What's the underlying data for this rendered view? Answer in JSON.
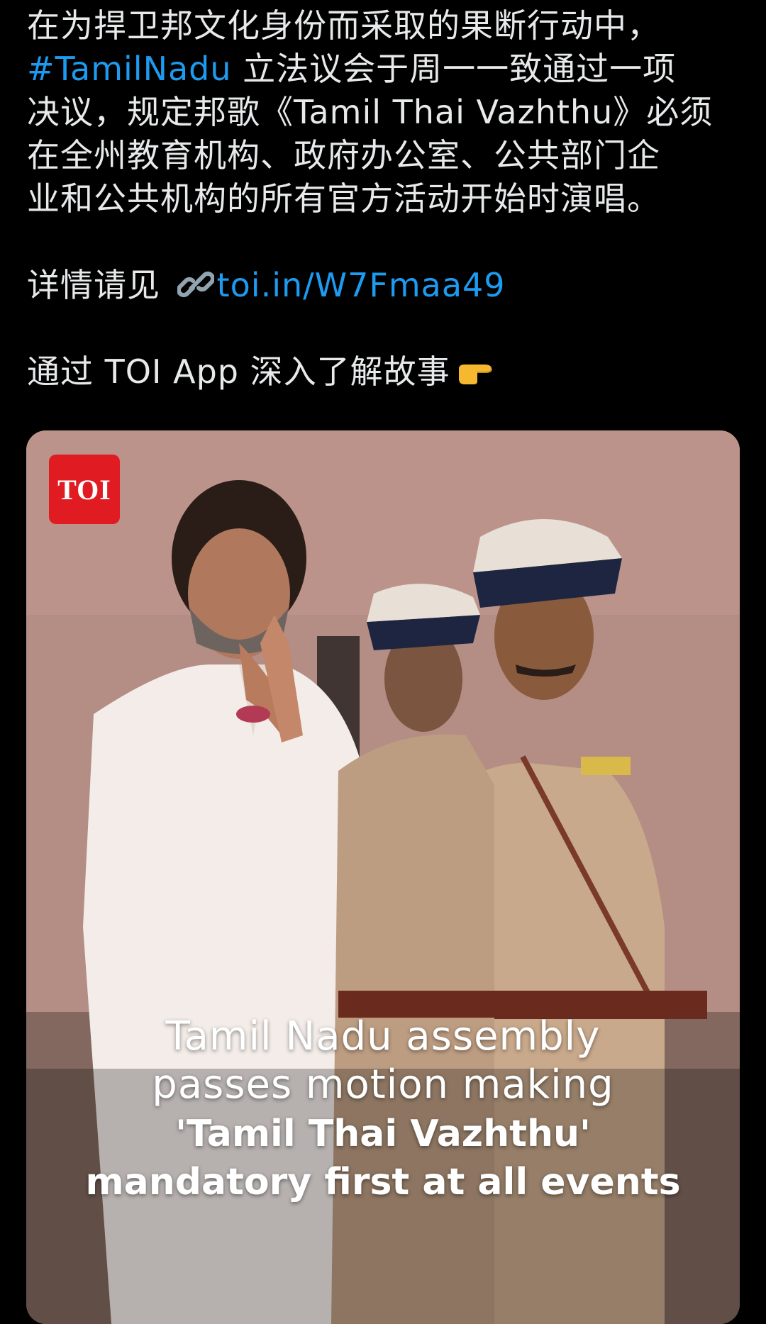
{
  "tweet": {
    "line1": "在为捍卫邦文化身份而采取的果断行动中，",
    "hashtag": "#TamilNadu",
    "line2_rest": " 立法议会于周一一致通过一项",
    "line3": "决议，规定邦歌《Tamil Thai Vazhthu》必须",
    "line4": "在全州教育机构、政府办公室、公共部门企",
    "line5": "业和公共机构的所有官方活动开始时演唱。",
    "details_prefix": "详情请见 ",
    "link_icon": "link-icon",
    "link_text": "toi.in/W7Fmaa49",
    "app_text": "通过 TOI App 深入了解故事",
    "emoji_icon": "pointing-right-icon"
  },
  "media": {
    "logo_text": "TOI",
    "caption_line1": "Tamil Nadu assembly",
    "caption_line2": "passes motion making",
    "caption_line3": "'Tamil Thai Vazhthu'",
    "caption_line4": "mandatory first at all events"
  },
  "colors": {
    "background": "#000000",
    "text": "#e7e9ea",
    "link": "#1d9bf0",
    "logo_red": "#e11b22"
  }
}
